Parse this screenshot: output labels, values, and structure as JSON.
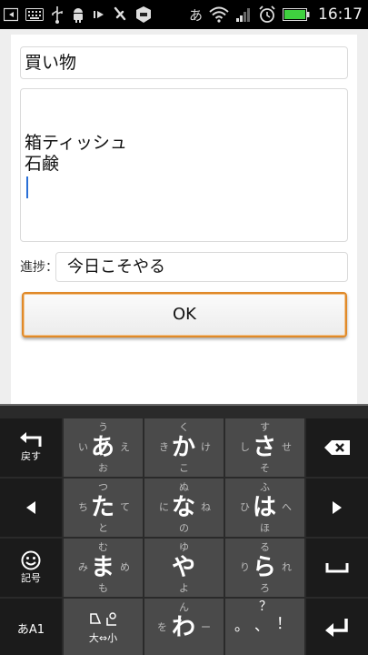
{
  "status_bar": {
    "ime_indicator": "あ",
    "time": "16:17",
    "icons": [
      "back-arrow-icon",
      "keyboard-icon",
      "usb-icon",
      "android-debug-icon",
      "media-icon",
      "app-notification-icon",
      "shield-icon",
      "wifi-icon",
      "signal-icon",
      "alarm-icon",
      "battery-icon"
    ],
    "battery_level": 1.0,
    "battery_color": "#3fd13f"
  },
  "form": {
    "title_value": "買い物",
    "memo_lines": [
      "箱ティッシュ",
      "石鹸"
    ],
    "progress_label": "進捗：",
    "progress_value": "今日こそやる",
    "ok_label": "OK",
    "accent_color": "#e08a2a"
  },
  "keyboard": {
    "back_label": "戻す",
    "symbol_label": "記号",
    "mode_label": "あA1",
    "case_label": "大⇔小",
    "rows": [
      [
        {
          "main": "あ",
          "top": "う",
          "left": "い",
          "right": "え",
          "bottom": "お"
        },
        {
          "main": "か",
          "top": "く",
          "left": "き",
          "right": "け",
          "bottom": "こ"
        },
        {
          "main": "さ",
          "top": "す",
          "left": "し",
          "right": "せ",
          "bottom": "そ"
        }
      ],
      [
        {
          "main": "た",
          "top": "つ",
          "left": "ち",
          "right": "て",
          "bottom": "と"
        },
        {
          "main": "な",
          "top": "ぬ",
          "left": "に",
          "right": "ね",
          "bottom": "の"
        },
        {
          "main": "は",
          "top": "ふ",
          "left": "ひ",
          "right": "へ",
          "bottom": "ほ"
        }
      ],
      [
        {
          "main": "ま",
          "top": "む",
          "left": "み",
          "right": "め",
          "bottom": "も"
        },
        {
          "main": "や",
          "top": "ゆ",
          "left": "",
          "right": "",
          "bottom": "よ"
        },
        {
          "main": "ら",
          "top": "る",
          "left": "り",
          "right": "れ",
          "bottom": "ろ"
        }
      ],
      [
        null,
        {
          "main": "わ",
          "top": "ん",
          "left": "を",
          "right": "ー",
          "bottom": ""
        },
        {
          "main": "！",
          "top": "？",
          "left": "。",
          "right": "、",
          "bottom": ""
        }
      ]
    ]
  }
}
